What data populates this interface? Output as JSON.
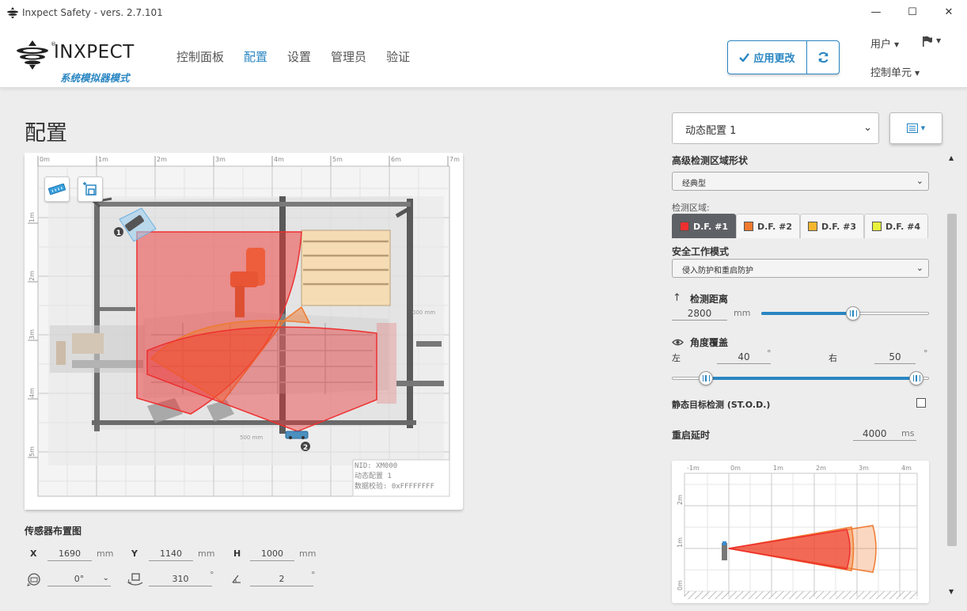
{
  "window": {
    "title": "Inxpect Safety - vers. 2.7.101"
  },
  "header": {
    "brand": "INXPECT",
    "brand_sub": "系统模拟器模式",
    "nav": [
      "控制面板",
      "配置",
      "设置",
      "管理员",
      "验证"
    ],
    "active_nav": "配置",
    "apply_label": "应用更改",
    "user_label": "用户",
    "control_unit_label": "控制单元"
  },
  "page": {
    "title": "配置"
  },
  "map": {
    "ruler_x": [
      "0m",
      "1m",
      "2m",
      "3m",
      "4m",
      "5m",
      "6m",
      "7m"
    ],
    "ruler_y": [
      "1m",
      "2m",
      "3m",
      "4m",
      "5m"
    ],
    "sensor_1": "1",
    "sensor_2": "2",
    "info": {
      "nid": "NID: XM000",
      "profile": "动态配置 1",
      "checksum": "数据校验: 0xFFFFFFFF"
    },
    "dim_label_1": "000 mm",
    "dim_label_2": "500 mm"
  },
  "sensor_layout": {
    "title": "传感器布置图",
    "x_label": "X",
    "x_value": "1690",
    "x_unit": "mm",
    "y_label": "Y",
    "y_value": "1140",
    "y_unit": "mm",
    "h_label": "H",
    "h_value": "1000",
    "h_unit": "mm",
    "rotation_value": "0°",
    "tilt_value": "310",
    "tilt_unit": "°",
    "inclination_value": "2",
    "inclination_unit": "°"
  },
  "right_panel": {
    "profile_select": "动态配置 1",
    "shape_label": "高级检测区域形状",
    "shape_value": "经典型",
    "fields_label": "检测区域:",
    "tabs": [
      {
        "label": "D.F. #1",
        "color": "#ee2f2f"
      },
      {
        "label": "D.F. #2",
        "color": "#f07a30"
      },
      {
        "label": "D.F. #3",
        "color": "#f6b62d"
      },
      {
        "label": "D.F. #4",
        "color": "#e9f23a"
      }
    ],
    "mode_label": "安全工作模式",
    "mode_value": "侵入防护和重启防护",
    "distance_label": "检测距离",
    "distance_value": "2800",
    "distance_unit": "mm",
    "distance_fraction": 0.55,
    "angle_label": "角度覆盖",
    "left_label": "左",
    "left_value": "40",
    "right_label": "右",
    "right_value": "50",
    "deg": "°",
    "stod_label": "静态目标检测 (ST.O.D.)",
    "restart_label": "重启延时",
    "restart_value": "4000",
    "restart_unit": "ms",
    "preview_ruler_x": [
      "-1m",
      "0m",
      "1m",
      "2m",
      "3m",
      "4m"
    ],
    "preview_ruler_y": [
      "2m",
      "1m",
      "0m"
    ]
  },
  "colors": {
    "accent": "#2a86c2",
    "field_red": "#ee2f2f",
    "field_orange": "#f07a30"
  }
}
